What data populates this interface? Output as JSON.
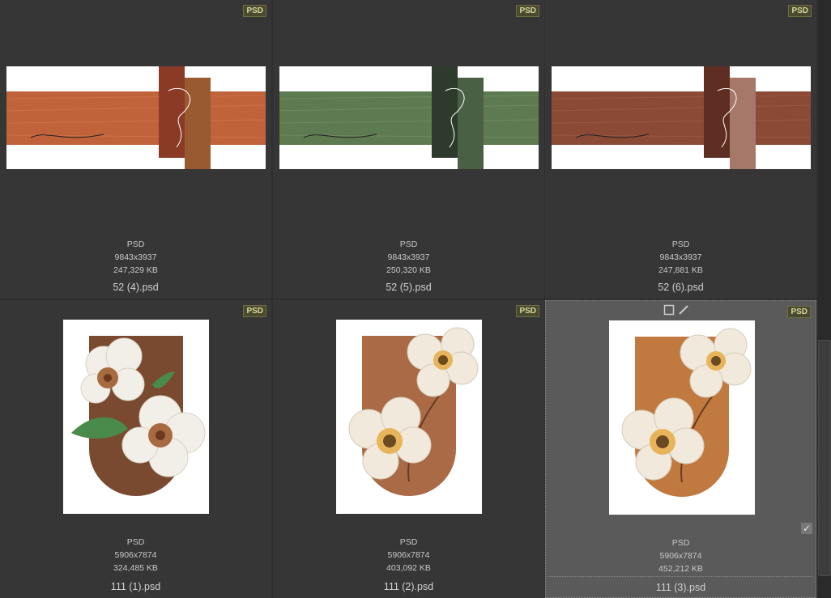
{
  "files": [
    {
      "badge": "PSD",
      "type": "PSD",
      "dimensions": "9843x3937",
      "size": "247,329 KB",
      "name": "52 (4).psd",
      "accent": "#c0623a"
    },
    {
      "badge": "PSD",
      "type": "PSD",
      "dimensions": "9843x3937",
      "size": "250,320 KB",
      "name": "52 (5).psd",
      "accent": "#5e7a50"
    },
    {
      "badge": "PSD",
      "type": "PSD",
      "dimensions": "9843x3937",
      "size": "247,881 KB",
      "name": "52 (6).psd",
      "accent": "#8a4a35"
    },
    {
      "badge": "PSD",
      "type": "PSD",
      "dimensions": "5906x7874",
      "size": "324,485 KB",
      "name": "111 (1).psd",
      "accent": "#7a4a30"
    },
    {
      "badge": "PSD",
      "type": "PSD",
      "dimensions": "5906x7874",
      "size": "403,092 KB",
      "name": "111 (2).psd",
      "accent": "#a96a45"
    },
    {
      "badge": "PSD",
      "type": "PSD",
      "dimensions": "5906x7874",
      "size": "452,212 KB",
      "name": "111 (3).psd",
      "accent": "#c07a40",
      "selected": true
    }
  ],
  "icons": {
    "square": "square-icon",
    "pencil": "pencil-icon",
    "check": "checkmark-icon"
  }
}
